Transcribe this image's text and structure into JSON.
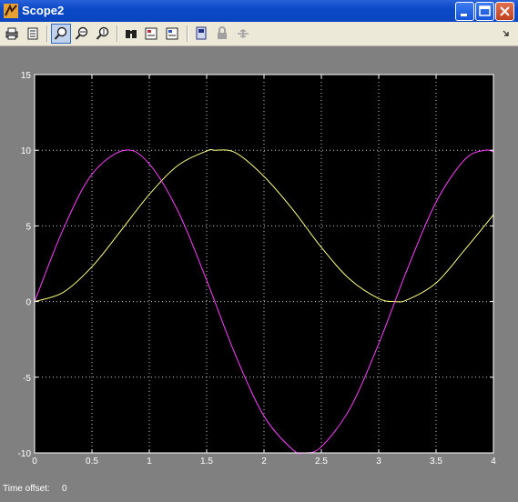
{
  "window": {
    "title": "Scope2"
  },
  "toolbar": {
    "buttons": [
      {
        "name": "print-icon"
      },
      {
        "name": "parameters-icon"
      },
      {
        "name": "zoom-icon"
      },
      {
        "name": "zoom-x-icon"
      },
      {
        "name": "zoom-y-icon"
      },
      {
        "name": "autoscale-binoculars-icon"
      },
      {
        "name": "save-axes-icon"
      },
      {
        "name": "restore-axes-icon"
      },
      {
        "name": "floating-scope-icon"
      },
      {
        "name": "lock-axes-icon"
      },
      {
        "name": "signal-selection-icon"
      }
    ]
  },
  "status": {
    "label": "Time offset:",
    "value": "0"
  },
  "chart_data": {
    "type": "line",
    "title": "",
    "xlabel": "",
    "ylabel": "",
    "xlim": [
      0,
      4
    ],
    "ylim": [
      -10,
      15
    ],
    "xticks": [
      "0",
      "0.5",
      "1",
      "1.5",
      "2",
      "2.5",
      "3",
      "3.5",
      "4"
    ],
    "yticks": [
      "-10",
      "-5",
      "0",
      "5",
      "10",
      "15"
    ],
    "grid": true,
    "background": "#000000",
    "series": [
      {
        "color": "#ffff80",
        "x": [
          0,
          0.25,
          0.5,
          0.75,
          1.0,
          1.25,
          1.5,
          1.571,
          1.75,
          2.0,
          2.25,
          2.5,
          2.75,
          3.0,
          3.142,
          3.25,
          3.5,
          3.75,
          4.0
        ],
        "y": [
          0,
          0.61,
          2.3,
          4.66,
          7.08,
          9.0,
          9.95,
          10,
          9.84,
          8.27,
          6.09,
          3.58,
          1.46,
          0.2,
          0,
          0.12,
          1.23,
          3.42,
          5.73
        ]
      },
      {
        "color": "#ff40ff",
        "x": [
          0,
          0.25,
          0.5,
          0.785,
          1.0,
          1.25,
          1.5,
          1.75,
          2.0,
          2.25,
          2.356,
          2.5,
          2.75,
          3.0,
          3.25,
          3.5,
          3.75,
          3.927,
          4.0
        ],
        "y": [
          0,
          4.79,
          8.41,
          10,
          9.09,
          5.98,
          1.41,
          -3.51,
          -7.57,
          -9.78,
          -10,
          -9.59,
          -7.06,
          -2.79,
          2.15,
          6.57,
          9.38,
          10,
          9.89
        ]
      }
    ]
  }
}
